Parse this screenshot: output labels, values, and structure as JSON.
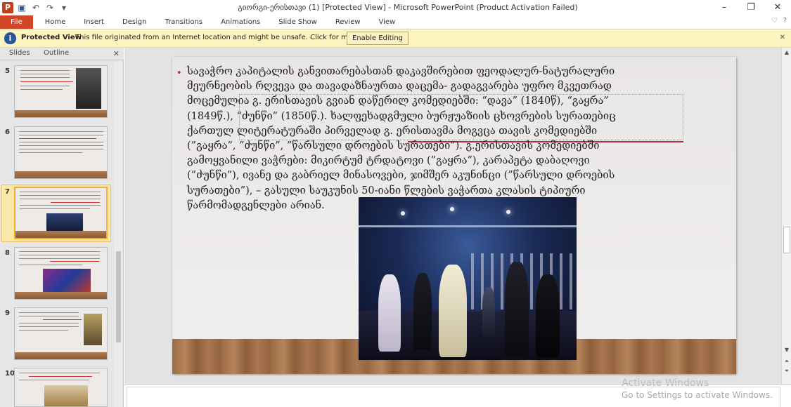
{
  "window": {
    "title": "გიორგი-ერისთავი (1) [Protected View]  -  Microsoft PowerPoint (Product Activation Failed)",
    "app_icon_letter": "P",
    "controls": {
      "minimize": "–",
      "restore": "❐",
      "close": "✕"
    }
  },
  "quick_access": {
    "save": "▣",
    "undo": "↶",
    "redo": "↷",
    "customize": "▾"
  },
  "ribbon_tabs": [
    {
      "label": "File"
    },
    {
      "label": "Home"
    },
    {
      "label": "Insert"
    },
    {
      "label": "Design"
    },
    {
      "label": "Transitions"
    },
    {
      "label": "Animations"
    },
    {
      "label": "Slide Show"
    },
    {
      "label": "Review"
    },
    {
      "label": "View"
    }
  ],
  "ribbon_right": {
    "collapse": "♡",
    "help": "?"
  },
  "protected_view": {
    "icon": "i",
    "title": "Protected View",
    "message": "This file originated from an Internet location and might be unsafe. Click for more details.",
    "button": "Enable Editing",
    "close": "✕"
  },
  "left_panel": {
    "tab_slides": "Slides",
    "tab_outline": "Outline",
    "close": "✕",
    "slides": [
      {
        "number": "5"
      },
      {
        "number": "6"
      },
      {
        "number": "7"
      },
      {
        "number": "8"
      },
      {
        "number": "9"
      },
      {
        "number": "10"
      }
    ]
  },
  "slide": {
    "bullet": "•",
    "text": "სავაჭრო კაპიტალის განვითარებასთან დაკავშირებით ფეოდალურ-ნატურალური მეურნეობის რღვევა და თავადაზნაურთა დაცემა- გადაგვარება უფრო მკვეთრად მოცემულია გ. ერისთავის გვიან დაწერილ კომედიებში: “დავა” (1840წ), “გაყრა” (1849წ.), “ძუნწი” (1850წ.). ხალფეხადგმული ბურჟუაზიის ცხოვრების სურათებიც ქართულ ლიტერატურაში პირველად გ. ერისთავმა მოგვცა თავის კომედიებში (”გაყრა”, ”ძუნწი”, ”წარსული დროების სურათები”). გ.ერისთავის კომედიებში გამოყვანილი ვაჭრები: მიკირტუმ ტრდატოვი (”გაყრა”), კარაპეტა დაბაღოვი (”ძუნწი”), ივანე და გაბრიელ მინასოვები, ჯიმშერ აკუნინცი (”წარსული დროების სურათები”), – გასული საუკუნის 50-იანი წლების ვაჭართა კლასის ტიპიური წარმომადგენლები არიან."
  },
  "watermark": {
    "title": "Activate Windows",
    "subtitle": "Go to Settings to activate Windows."
  }
}
